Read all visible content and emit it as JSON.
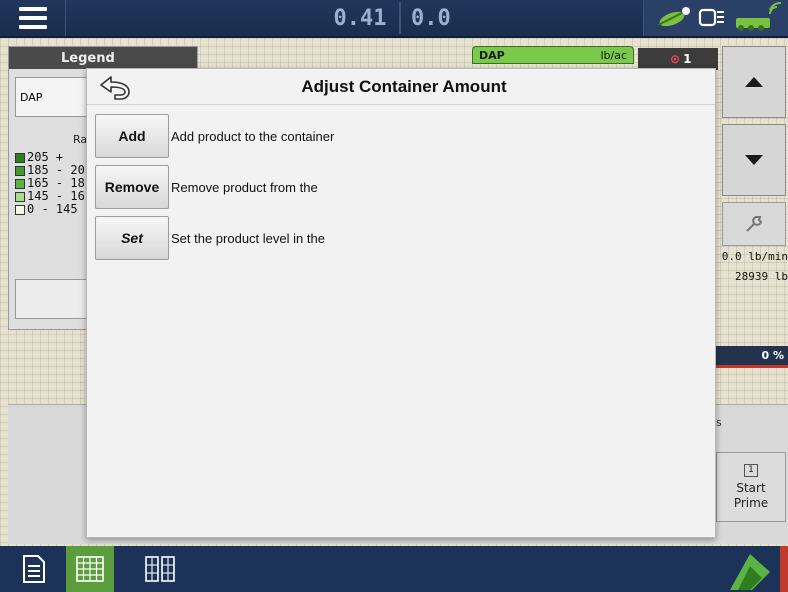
{
  "topbar": {
    "applied_rate": "0.41",
    "target_rate": "0.0"
  },
  "legend": {
    "title": "Legend",
    "product": "DAP",
    "rate_header": "Ra",
    "ranges": [
      {
        "label": "205 +",
        "color": "#2e7d1f"
      },
      {
        "label": "185 - 20",
        "color": "#3f9c2b"
      },
      {
        "label": "165 - 18",
        "color": "#5ab443"
      },
      {
        "label": "145 - 16",
        "color": "#a6dc8a"
      },
      {
        "label": "0 - 145",
        "color": "#f2f7ee"
      }
    ]
  },
  "map_tab": {
    "product": "DAP",
    "unit": "lb/ac"
  },
  "alarm": {
    "count": "1"
  },
  "readouts": {
    "flow_rate": "0.0 lb/min",
    "weight": "28939 lb",
    "percent": "0 %",
    "truncated_label": "s"
  },
  "prime": {
    "number": "1",
    "label_line1": "Start",
    "label_line2": "Prime"
  },
  "modal": {
    "title": "Adjust Container Amount",
    "options": [
      {
        "button": "Add",
        "description": "Add product to the container"
      },
      {
        "button": "Remove",
        "description": "Remove product from the"
      },
      {
        "button": "Set",
        "description": "Set the product level in the"
      }
    ]
  },
  "colors": {
    "accent_green": "#5b9d3d",
    "bar_blue": "#1d3258",
    "alarm_red": "#ff4b4b"
  }
}
